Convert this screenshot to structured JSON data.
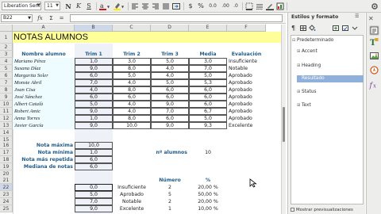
{
  "toolbar": {
    "font_name": "Liberation Serif",
    "font_size": "11",
    "bold": "N",
    "italic": "K",
    "underline": "S",
    "currency": "$",
    "percent": "%",
    "decimal": "0.0",
    "sum": "Σ",
    "sort": "⇅"
  },
  "formula_bar": {
    "cell_ref": "B22",
    "fx": "fx",
    "sum": "Σ",
    "eq": "=",
    "value": ""
  },
  "grid": {
    "columns": [
      "A",
      "B",
      "C",
      "D",
      "E",
      "F"
    ],
    "rows": [
      1,
      2,
      3,
      4,
      5,
      6,
      7,
      8,
      9,
      10,
      11,
      12,
      13,
      14,
      15,
      16,
      17,
      18,
      19,
      20,
      21,
      22,
      23,
      24,
      25
    ],
    "title": "NOTAS ALUMNOS",
    "headers": [
      "Nombre alumno",
      "Trim 1",
      "Trim 2",
      "Trim 3",
      "Media",
      "Evaluación"
    ],
    "students": [
      [
        "Mariano Pérez",
        "1,0",
        "3,0",
        "5,0",
        "3,0",
        "Insuficiente"
      ],
      [
        "Susana Díaz",
        "9,0",
        "8,0",
        "4,0",
        "7,0",
        "Notable"
      ],
      [
        "Margarita Soler",
        "6,0",
        "5,0",
        "4,0",
        "5,0",
        "Aprobado"
      ],
      [
        "Monste Abril",
        "7,0",
        "4,0",
        "5,0",
        "5,3",
        "Aprobado"
      ],
      [
        "Joan Cisa",
        "4,0",
        "8,0",
        "6,0",
        "6,0",
        "Aprobado"
      ],
      [
        "José Sánchez",
        "6,0",
        "6,0",
        "6,0",
        "6,0",
        "Aprobado"
      ],
      [
        "Albert Català",
        "5,0",
        "4,0",
        "9,0",
        "6,0",
        "Aprobado"
      ],
      [
        "Robert Amic",
        "9,0",
        "4,0",
        "7,0",
        "6,7",
        "Aprobado"
      ],
      [
        "Anna Torres",
        "1,0",
        "8,0",
        "6,0",
        "5,0",
        "Aprobado"
      ],
      [
        "Javier García",
        "9,0",
        "10,0",
        "9,0",
        "9,3",
        "Excelente"
      ]
    ],
    "stats": [
      {
        "label": "Nota máxima",
        "value": "10,0"
      },
      {
        "label": "Nota mínima",
        "value": "1,0"
      },
      {
        "label": "Nota más repetida",
        "value": "6,0"
      },
      {
        "label": "Mediana de notas",
        "value": "6,0"
      }
    ],
    "num_alumnos_label": "nº alumnos",
    "num_alumnos_value": "10",
    "dist_headers": [
      "Número",
      "%"
    ],
    "distribution": [
      [
        "0,0",
        "Insuficiente",
        "2",
        "20,00 %"
      ],
      [
        "5,0",
        "Aprobado",
        "5",
        "50,00 %"
      ],
      [
        "7,0",
        "Notable",
        "2",
        "20,00 %"
      ],
      [
        "9,0",
        "Excelente",
        "1",
        "10,00 %"
      ]
    ]
  },
  "sidebar": {
    "title": "Estilos y formato",
    "menu": "☰",
    "tree": [
      {
        "label": "Predeterminado",
        "toggle": "⊟"
      },
      {
        "label": "Accent",
        "toggle": "⊞"
      },
      {
        "label": "Heading",
        "toggle": "⊞"
      },
      {
        "label": "Resultado",
        "toggle": ""
      },
      {
        "label": "Status",
        "toggle": "⊞"
      },
      {
        "label": "Text",
        "toggle": "⊞"
      }
    ],
    "preview_label": "Mostrar previsualizaciones"
  },
  "colors": {
    "title_bg": "#ffff99",
    "student_name_bg": "#eefbff",
    "header_text": "#1f5c8a",
    "selection": "#8fb0da"
  }
}
